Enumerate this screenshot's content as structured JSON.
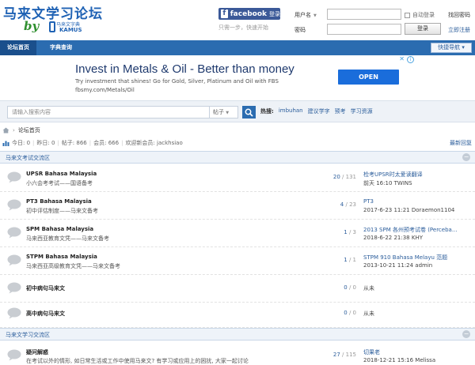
{
  "header": {
    "site_title": "马来文学习论坛",
    "by_text": "by",
    "badge_cn": "马来文字典",
    "badge_en": "KAMUS",
    "fb_brand": "facebook",
    "fb_action": "登录",
    "fb_hint": "只需一步，快速开始",
    "user_label": "用户名",
    "password_label": "密码",
    "remember_label": "自动登录",
    "forgot_label": "找回密码",
    "login_button": "登录",
    "register_label": "立即注册"
  },
  "nav": {
    "home": "论坛首页",
    "dict": "字典查询",
    "quick_nav": "快捷导航"
  },
  "ad": {
    "title": "Invest in Metals & Oil - Better than money",
    "description": "Try investment that shines! Go for Gold, Silver, Platinum and Oil with FBS",
    "url": "fbsmy.com/Metals/Oil",
    "button": "OPEN"
  },
  "search": {
    "placeholder": "请输入搜索内容",
    "type": "帖子",
    "hot_label": "热搜:",
    "hot_words": [
      "imbuhan",
      "建议学字",
      "预考",
      "学习资源"
    ]
  },
  "breadcrumb": {
    "current": "论坛首页"
  },
  "stats": {
    "today": "今日: 0",
    "yesterday": "昨日: 0",
    "posts": "帖子: 866",
    "members": "会员: 666",
    "welcome": "欢迎新会员: jackhsiao",
    "latest": "最新回复"
  },
  "sections": [
    {
      "title": "马来文考试交流区",
      "forums": [
        {
          "name": "UPSR Bahasa Malaysia",
          "desc": "小六会考考试——国语备考",
          "threads": "20",
          "posts": "131",
          "last_title": "检考UPSR时太爱读翻译",
          "last_meta": "前天 16:10 TWINS"
        },
        {
          "name": "PT3 Bahasa Malaysia",
          "desc": "初中评估制度——马来文备考",
          "threads": "4",
          "posts": "23",
          "last_title": "PT3",
          "last_meta": "2017-6-23 11:21 Doraemon1104"
        },
        {
          "name": "SPM Bahasa Malaysia",
          "desc": "马来西亚教育文凭——马来文备考",
          "threads": "1",
          "posts": "3",
          "last_title": "2013 SPM 各州预考试卷 (Perceba...",
          "last_meta": "2018-6-22 21:38 KHY"
        },
        {
          "name": "STPM Bahasa Malaysia",
          "desc": "马来西亚高级教育文凭——马来文备考",
          "threads": "1",
          "posts": "1",
          "last_title": "STPM 910 Bahasa Melayu 范题",
          "last_meta": "2013-10-21 11:24 admin"
        },
        {
          "name": "初中病句马来文",
          "desc": "",
          "threads": "0",
          "posts": "0",
          "last_title": "",
          "last_meta": "从未"
        },
        {
          "name": "高中病句马来文",
          "desc": "",
          "threads": "0",
          "posts": "0",
          "last_title": "",
          "last_meta": "从未"
        }
      ]
    },
    {
      "title": "马来文学习交流区",
      "forums": [
        {
          "name": "疑问解惑",
          "desc": "在考试以外的情形, 如日常生活或工作中使用马来文? 有学习或应用上的困扰, 大家一起讨论",
          "threads": "27",
          "posts": "115",
          "last_title": "切果老",
          "last_meta": "2018-12-21 15:16 Melissa"
        }
      ]
    }
  ]
}
